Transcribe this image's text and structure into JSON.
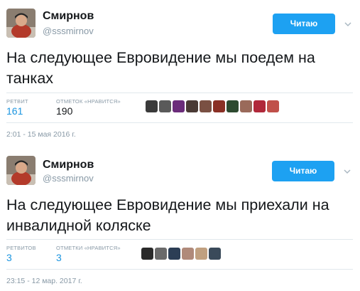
{
  "tweets": [
    {
      "name": "Смирнов",
      "handle": "@sssmirnov",
      "follow_label": "Читаю",
      "text": "На следующее Евровидение мы поедем на танках",
      "retweets_label": "РЕТВИТ",
      "retweets_value": "161",
      "likes_label": "ОТМЕТОК «НРАВИТСЯ»",
      "likes_value": "190",
      "timestamp": "2:01 - 15 мая 2016 г.",
      "liker_colors": [
        "#3a3a3a",
        "#5a5a5a",
        "#6b2c7a",
        "#4a3a35",
        "#7a5043",
        "#8a3025",
        "#2d4a30",
        "#9a6a5a",
        "#b0283a",
        "#c0504a"
      ]
    },
    {
      "name": "Смирнов",
      "handle": "@sssmirnov",
      "follow_label": "Читаю",
      "text": "На следующее Евровидение мы приехали на инвалидной коляске",
      "retweets_label": "РЕТВИТОВ",
      "retweets_value": "3",
      "likes_label": "ОТМЕТКИ «НРАВИТСЯ»",
      "likes_value": "3",
      "timestamp": "23:15 - 12 мар. 2017 г.",
      "liker_colors": [
        "#2a2a2a",
        "#6a6a6a",
        "#2c3e55",
        "#b08a7a",
        "#c0a080",
        "#3a4a5a"
      ]
    }
  ]
}
